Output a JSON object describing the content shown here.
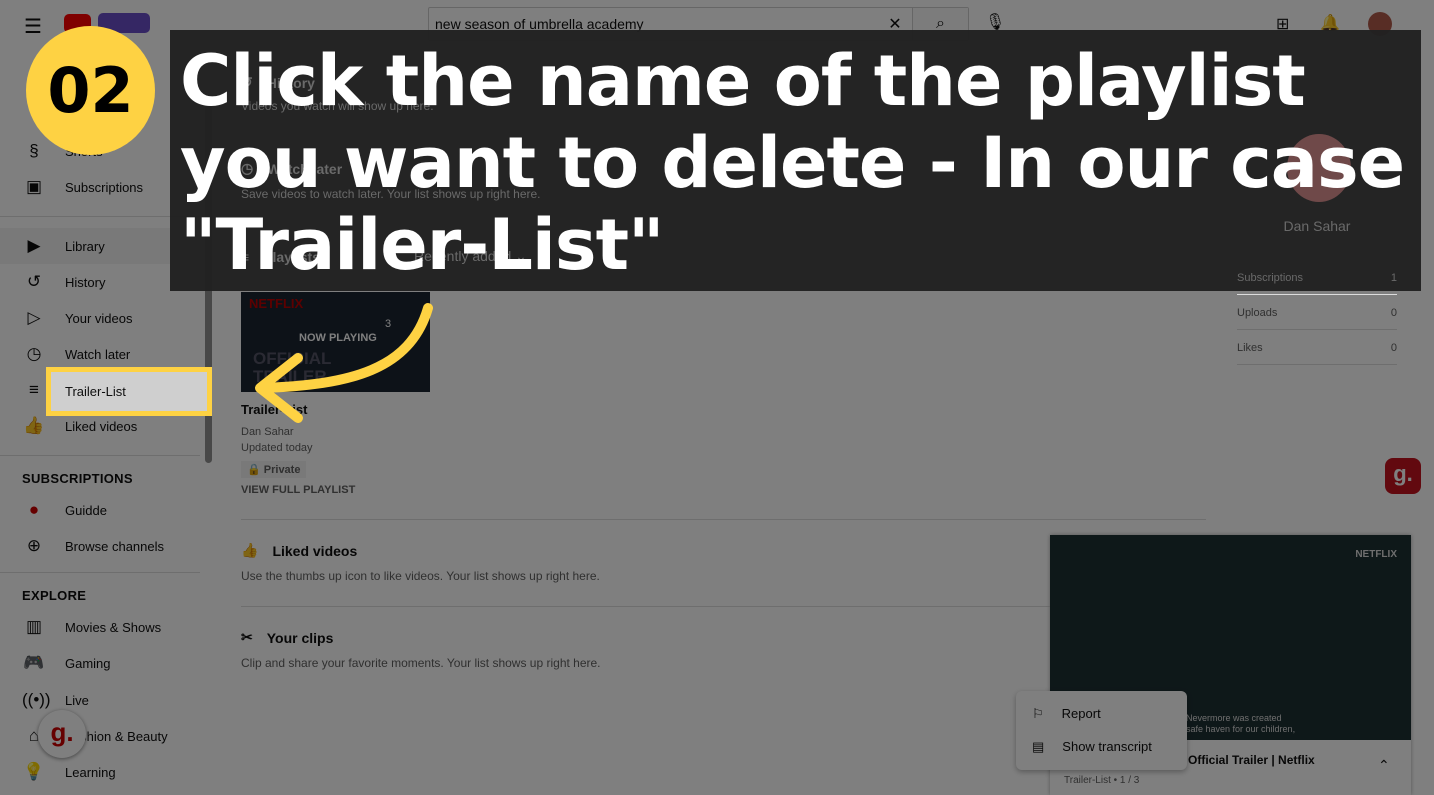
{
  "header": {
    "search_value": "new season of umbrella academy"
  },
  "sidebar": {
    "items_top": [
      {
        "label": "Shorts",
        "icon": "shorts-icon"
      },
      {
        "label": "Subscriptions",
        "icon": "subscriptions-icon"
      }
    ],
    "items_lib": [
      {
        "label": "Library",
        "icon": "library-icon"
      },
      {
        "label": "History",
        "icon": "history-icon"
      },
      {
        "label": "Your videos",
        "icon": "your-videos-icon"
      },
      {
        "label": "Watch later",
        "icon": "watch-later-icon"
      },
      {
        "label": "Trailer-List",
        "icon": "playlist-icon"
      },
      {
        "label": "Liked videos",
        "icon": "thumbs-up-icon"
      }
    ],
    "subs_heading": "SUBSCRIPTIONS",
    "subs": [
      {
        "label": "Guidde",
        "icon": "guidde-avatar"
      },
      {
        "label": "Browse channels",
        "icon": "add-circle-icon"
      }
    ],
    "explore_heading": "EXPLORE",
    "explore": [
      {
        "label": "Movies & Shows",
        "icon": "film-icon"
      },
      {
        "label": "Gaming",
        "icon": "gamepad-icon"
      },
      {
        "label": "Live",
        "icon": "live-icon"
      },
      {
        "label": "Fashion & Beauty",
        "icon": "hanger-icon"
      },
      {
        "label": "Learning",
        "icon": "bulb-icon"
      }
    ]
  },
  "main": {
    "history": {
      "title": "History",
      "desc": "Videos you watch will show up here."
    },
    "watch_later": {
      "title": "Watch later",
      "desc": "Save videos to watch later. Your list shows up right here."
    },
    "playlists": {
      "title": "Playlists",
      "sort": "Recently added"
    },
    "playlist_card": {
      "title": "Trailer-List",
      "owner": "Dan Sahar",
      "updated": "Updated today",
      "privacy": "Private",
      "view_full": "VIEW FULL PLAYLIST",
      "now_playing": "NOW PLAYING",
      "count": "3",
      "thumb_brand": "NETFLIX",
      "thumb_text": "OFFICIAL TRAILER"
    },
    "liked": {
      "title": "Liked videos",
      "desc": "Use the thumbs up icon to like videos. Your list shows up right here."
    },
    "clips": {
      "title": "Your clips",
      "desc": "Clip and share your favorite moments. Your list shows up right here."
    }
  },
  "profile": {
    "name": "Dan Sahar",
    "stats": [
      {
        "label": "Subscriptions",
        "value": "1"
      },
      {
        "label": "Uploads",
        "value": "0"
      },
      {
        "label": "Likes",
        "value": "0"
      }
    ]
  },
  "miniplayer": {
    "brand": "NETFLIX",
    "caption1": "Nevermore was created",
    "caption2": "safe haven for our children,",
    "title": "Official Trailer | Netflix",
    "playlist": "Trailer-List • 1 / 3"
  },
  "context_menu": [
    "Report",
    "Show transcript"
  ],
  "overlay": {
    "step": "02",
    "instruction": "Click the name of the playlist you want to delete - In our case \"Trailer-List\"",
    "accent": "#fed243"
  }
}
